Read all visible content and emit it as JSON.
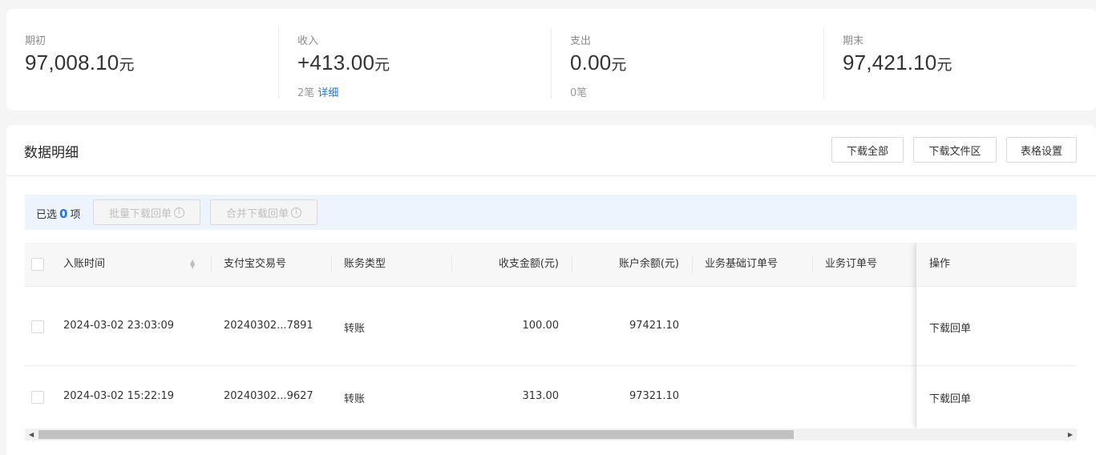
{
  "summary": {
    "opening": {
      "label": "期初",
      "value": "97,008.10",
      "unit": "元"
    },
    "income": {
      "label": "收入",
      "value": "+413.00",
      "unit": "元",
      "count": "2笔",
      "detail_link": "详细"
    },
    "expense": {
      "label": "支出",
      "value": "0.00",
      "unit": "元",
      "count": "0笔"
    },
    "closing": {
      "label": "期末",
      "value": "97,421.10",
      "unit": "元"
    }
  },
  "panel": {
    "title": "数据明细",
    "buttons": {
      "download_all": "下载全部",
      "download_files": "下载文件区",
      "table_settings": "表格设置"
    }
  },
  "selection": {
    "prefix": "已选",
    "count": "0",
    "suffix": "项",
    "batch_download": "批量下载回单",
    "merge_download": "合并下载回单"
  },
  "table": {
    "headers": {
      "time": "入账时间",
      "alipay_no": "支付宝交易号",
      "type": "账务类型",
      "amount": "收支金额(元)",
      "balance": "账户余额(元)",
      "base_order": "业务基础订单号",
      "order": "业务订单号",
      "action": "操作"
    },
    "rows": [
      {
        "time": "2024-03-02 23:03:09",
        "alipay_no": "20240302...7891",
        "type": "转账",
        "amount": "100.00",
        "balance": "97421.10",
        "base_order": "",
        "order": "",
        "action": "下载回单"
      },
      {
        "time": "2024-03-02 15:22:19",
        "alipay_no": "20240302...9627",
        "type": "转账",
        "amount": "313.00",
        "balance": "97321.10",
        "base_order": "",
        "order": "",
        "action": "下载回单"
      }
    ]
  },
  "colors": {
    "accent": "#1677ff",
    "selection_bar": "#eef4fd",
    "header_bg": "#f7f7f7"
  }
}
